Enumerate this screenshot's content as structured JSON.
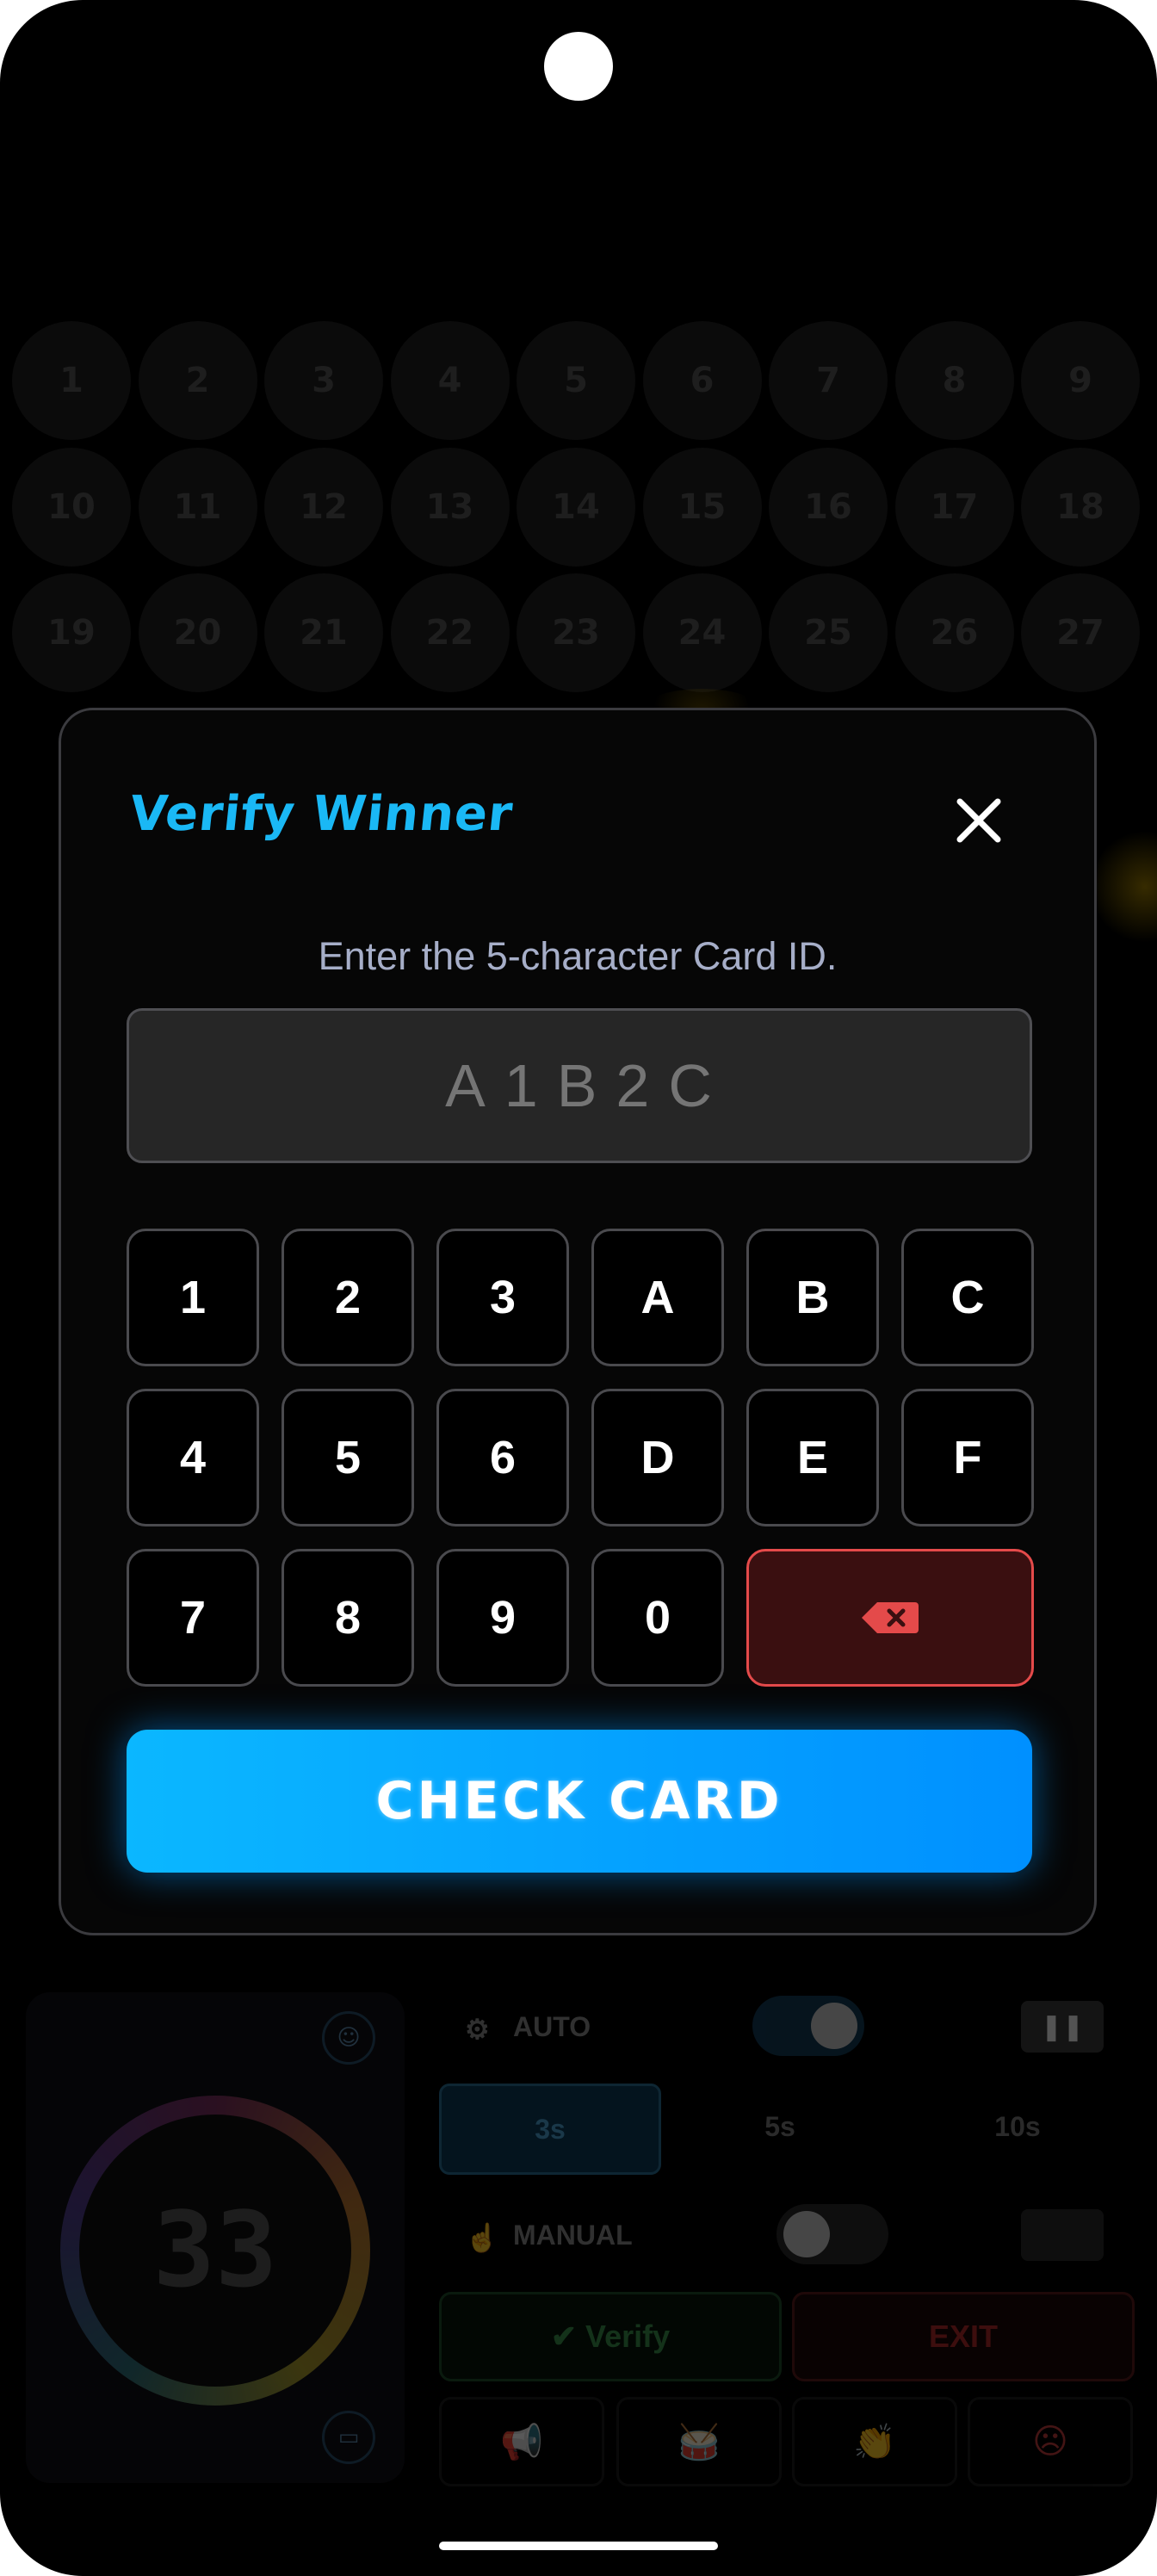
{
  "board": {
    "balls": [
      "1",
      "2",
      "3",
      "4",
      "5",
      "6",
      "7",
      "8",
      "9",
      "10",
      "11",
      "12",
      "13",
      "14",
      "15",
      "16",
      "17",
      "18",
      "19",
      "20",
      "21",
      "22",
      "23",
      "24",
      "25",
      "26",
      "27"
    ]
  },
  "controls": {
    "timer_value": "33",
    "auto_label": "AUTO",
    "manual_label": "MANUAL",
    "intervals": [
      "3s",
      "5s",
      "10s"
    ],
    "pause_label": "❚❚",
    "verify_label": "Verify",
    "exit_label": "EXIT",
    "icon_buttons": [
      {
        "name": "megaphone-icon",
        "glyph": "📢"
      },
      {
        "name": "drum-icon",
        "glyph": "🥁"
      },
      {
        "name": "clap-icon",
        "glyph": "👏"
      },
      {
        "name": "sad-face-icon",
        "glyph": "☹"
      }
    ]
  },
  "modal": {
    "title": "Verify Winner",
    "subtitle": "Enter the 5-character Card ID.",
    "card_id": {
      "value": "",
      "placeholder": "A1B2C"
    },
    "keypad": {
      "rows": [
        [
          "1",
          "2",
          "3",
          "A",
          "B",
          "C"
        ],
        [
          "4",
          "5",
          "6",
          "D",
          "E",
          "F"
        ],
        [
          "7",
          "8",
          "9",
          "0"
        ]
      ],
      "backspace_icon": "backspace-icon"
    },
    "check_button": "CHECK CARD",
    "colors": {
      "title": "#1ab8f5",
      "button_start": "#0bb7ff",
      "button_end": "#0090ff",
      "backspace": "#e44a4a"
    }
  }
}
